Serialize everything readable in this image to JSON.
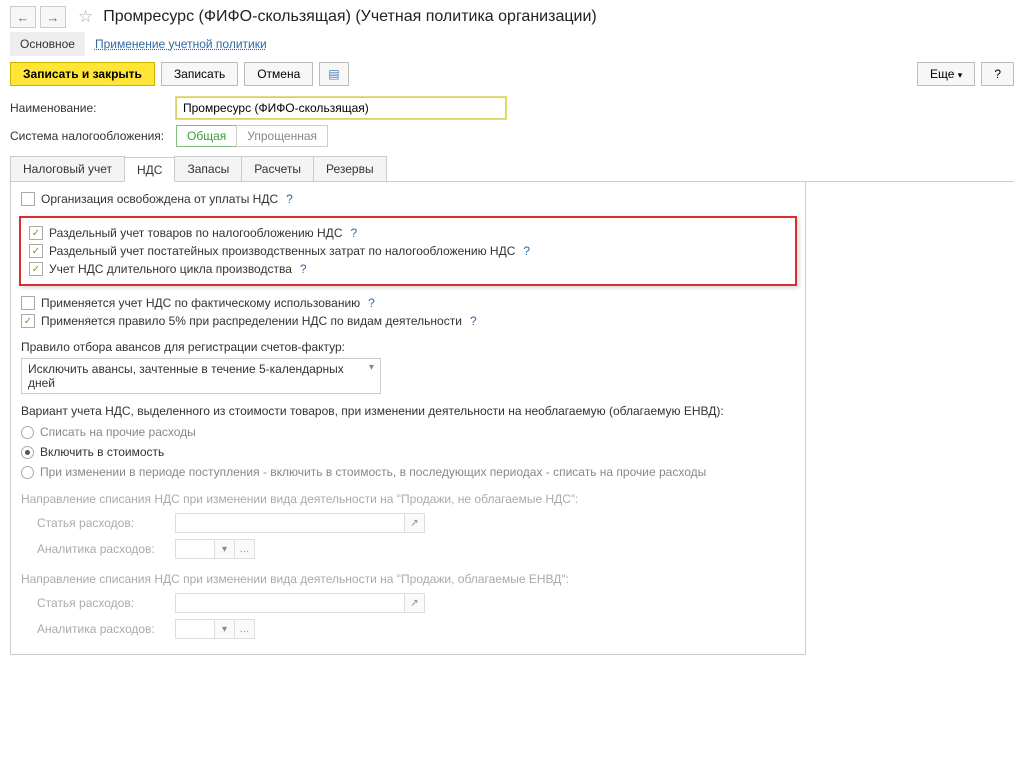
{
  "header": {
    "title": "Промресурс (ФИФО-скользящая) (Учетная политика организации)"
  },
  "main_tabs": {
    "active": "Основное",
    "link": "Применение учетной политики"
  },
  "toolbar": {
    "save_close": "Записать и закрыть",
    "save": "Записать",
    "cancel": "Отмена",
    "more": "Еще",
    "help": "?"
  },
  "form": {
    "name_label": "Наименование:",
    "name_value": "Промресурс (ФИФО-скользящая)",
    "tax_system_label": "Система налогообложения:",
    "tax_general": "Общая",
    "tax_simplified": "Упрощенная"
  },
  "sub_tabs": [
    "Налоговый учет",
    "НДС",
    "Запасы",
    "Расчеты",
    "Резервы"
  ],
  "sub_tab_active": "НДС",
  "vat": {
    "exempt": "Организация освобождена от уплаты НДС",
    "box1": "Раздельный учет товаров по налогообложению НДС",
    "box2": "Раздельный учет постатейных производственных затрат по налогообложению НДС",
    "box3": "Учет НДС длительного цикла производства",
    "factual": "Применяется учет НДС по фактическому использованию",
    "rule5": "Применяется правило 5% при распределении НДС по видам деятельности",
    "advance_rule_label": "Правило отбора авансов для регистрации счетов-фактур:",
    "advance_rule_value": "Исключить авансы, зачтенные в течение 5-календарных дней",
    "variant_label": "Вариант учета НДС, выделенного из стоимости товаров, при изменении деятельности на необлагаемую (облагаемую ЕНВД):",
    "radio1": "Списать на прочие расходы",
    "radio2": "Включить в стоимость",
    "radio3": "При изменении в периоде поступления - включить в стоимость, в последующих периодах - списать на прочие расходы",
    "dir1_label": "Направление списания НДС при изменении вида деятельности на \"Продажи, не облагаемые НДС\":",
    "dir2_label": "Направление списания НДС при изменении вида деятельности на \"Продажи, облагаемые ЕНВД\":",
    "expense_item": "Статья расходов:",
    "expense_analytics": "Аналитика расходов:"
  }
}
